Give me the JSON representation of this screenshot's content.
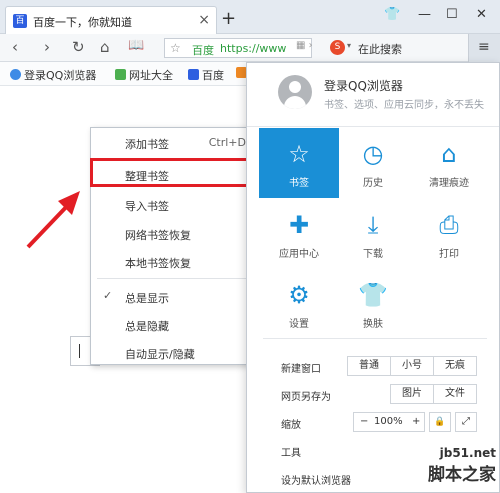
{
  "tab": {
    "favicon": "百",
    "title": "百度一下，你就知道",
    "close": "×",
    "new_tab": "+"
  },
  "window": {
    "skin": "👕",
    "minimize": "—",
    "maximize": "☐",
    "close": "✕"
  },
  "toolbar": {
    "back": "‹",
    "forward": "›",
    "refresh": "↻",
    "home": "⌂",
    "reader": "📖",
    "star": "☆",
    "site": "百度",
    "url": "https://www",
    "addr_icons": "▦  ›",
    "search_logo": "S",
    "search_text": "在此搜索",
    "menu": "≡"
  },
  "bookmarks": [
    {
      "label": "登录QQ浏览器",
      "color": "#3d8be6"
    },
    {
      "label": "网址大全",
      "color": "#4caf50"
    },
    {
      "label": "百度",
      "color": "#2e5fe0"
    },
    {
      "label": "",
      "color": "#f08a24"
    }
  ],
  "context_menu": {
    "items": [
      {
        "label": "添加书签",
        "shortcut": "Ctrl+D",
        "check": ""
      },
      {
        "label": "整理书签",
        "shortcut": "",
        "check": ""
      },
      {
        "label": "导入书签",
        "shortcut": "",
        "check": ""
      },
      {
        "label": "网络书签恢复",
        "shortcut": "",
        "check": ""
      },
      {
        "label": "本地书签恢复",
        "shortcut": "",
        "check": ""
      },
      {
        "label": "总是显示",
        "shortcut": "",
        "check": "✓"
      },
      {
        "label": "总是隐藏",
        "shortcut": "",
        "check": ""
      },
      {
        "label": "自动显示/隐藏",
        "shortcut": "",
        "check": ""
      }
    ]
  },
  "panel": {
    "account_title": "登录QQ浏览器",
    "account_subtitle": "书签、选项、应用云同步，永不丢失",
    "grid": [
      {
        "icon": "☆",
        "label": "书签",
        "active": true
      },
      {
        "icon": "◷",
        "label": "历史"
      },
      {
        "icon": "⌂",
        "label": "清理痕迹"
      },
      {
        "icon": "✚",
        "label": "应用中心"
      },
      {
        "icon": "⤓",
        "label": "下载"
      },
      {
        "icon": "⎙",
        "label": "打印"
      },
      {
        "icon": "⚙",
        "label": "设置"
      },
      {
        "icon": "👕",
        "label": "换肤"
      }
    ],
    "rows": {
      "new_window": {
        "label": "新建窗口",
        "opts": [
          "普通",
          "小号",
          "无痕"
        ]
      },
      "save_as": {
        "label": "网页另存为",
        "opts": [
          "图片",
          "文件"
        ]
      },
      "zoom": {
        "label": "缩放",
        "minus": "−",
        "value": "100%",
        "plus": "+",
        "lock": "🔒",
        "expand": "⤢"
      },
      "tools": {
        "label": "工具"
      },
      "default": {
        "label": "设为默认浏览器"
      }
    }
  },
  "watermark": {
    "line1": "jb51.net",
    "line2": "脚本之家"
  },
  "colors": {
    "accent": "#1a8fd6",
    "highlight": "#e21e25",
    "arrow": "#e21e25"
  }
}
